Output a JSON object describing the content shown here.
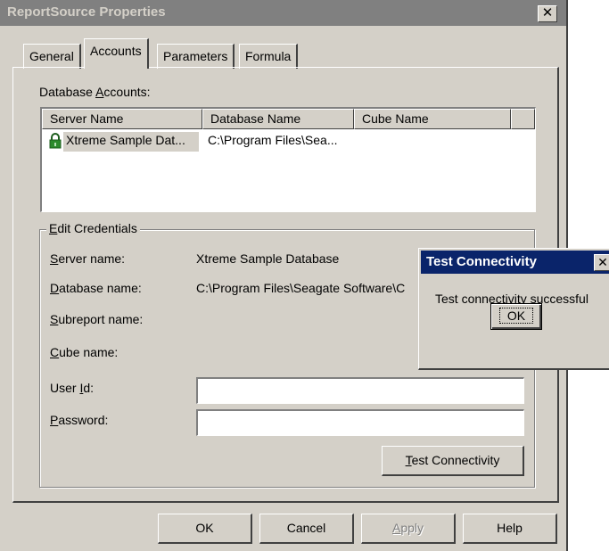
{
  "window": {
    "title": "ReportSource Properties",
    "close_glyph": "✕"
  },
  "tabs": [
    {
      "label": "General",
      "active": false
    },
    {
      "label": "Accounts",
      "active": true
    },
    {
      "label": "Parameters",
      "active": false
    },
    {
      "label": "Formula",
      "active": false
    }
  ],
  "accounts": {
    "label_pre": "Database ",
    "label_u": "A",
    "label_post": "ccounts:",
    "columns": [
      "Server Name",
      "Database Name",
      "Cube Name"
    ],
    "rows": [
      {
        "server": "Xtreme Sample Dat...",
        "database": "C:\\Program Files\\Sea...",
        "cube": "",
        "icon": "lock-icon"
      }
    ]
  },
  "credentials": {
    "group_pre": "",
    "group_u": "E",
    "group_post": "dit Credentials",
    "fields": [
      {
        "pre": "",
        "u": "S",
        "post": "erver name:",
        "value": "Xtreme Sample Database"
      },
      {
        "pre": "",
        "u": "D",
        "post": "atabase name:",
        "value": "C:\\Program Files\\Seagate Software\\C"
      },
      {
        "pre": "",
        "u": "S",
        "post": "ubreport name:",
        "value": ""
      },
      {
        "pre": "",
        "u": "C",
        "post": "ube name:",
        "value": ""
      }
    ],
    "user_id": {
      "pre": "User ",
      "u": "I",
      "post": "d:",
      "value": ""
    },
    "password": {
      "pre": "",
      "u": "P",
      "post": "assword:",
      "value": ""
    },
    "test_button": {
      "pre": "",
      "u": "T",
      "post": "est Connectivity"
    }
  },
  "footer": {
    "ok": "OK",
    "cancel": "Cancel",
    "apply": {
      "pre": "",
      "u": "A",
      "post": "pply"
    },
    "help": "Help"
  },
  "dialog": {
    "title": "Test Connectivity",
    "close_glyph": "✕",
    "message": "Test connectivity successful",
    "ok": "OK"
  },
  "colors": {
    "face": "#d4d0c8",
    "inactive_title": "#808080",
    "active_title": "#0a246a",
    "lock_green": "#2d8a2d"
  }
}
